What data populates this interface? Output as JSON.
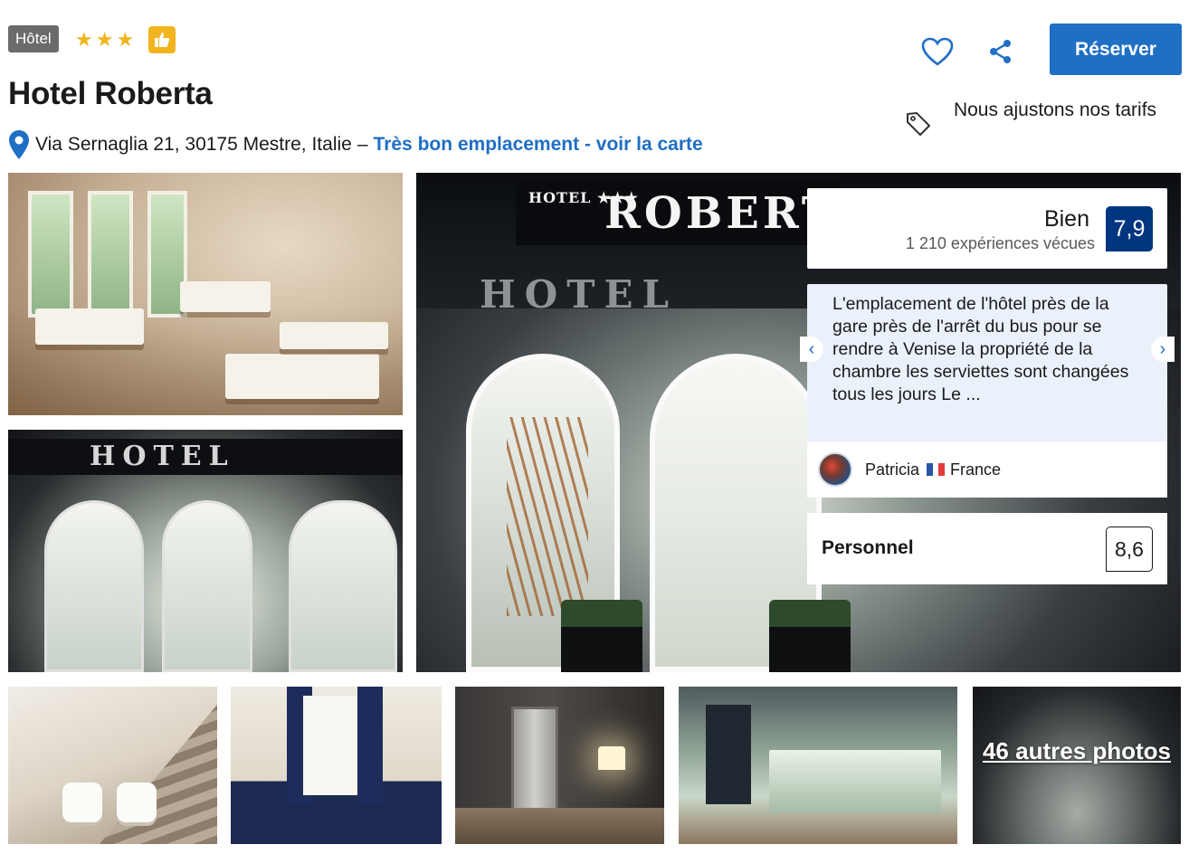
{
  "header": {
    "type_badge": "Hôtel",
    "stars": [
      "★",
      "★",
      "★"
    ],
    "title": "Hotel Roberta",
    "address": "Via Sernaglia 21, 30175 Mestre, Italie",
    "separator": "–",
    "map_link": "Très bon emplacement - voir la carte"
  },
  "actions": {
    "reserve_label": "Réserver",
    "price_note": "Nous ajustons nos tarifs",
    "icons": [
      "heart-icon",
      "share-icon",
      "tag-icon",
      "location-pin-icon",
      "thumbs-up-icon"
    ]
  },
  "colors": {
    "brand_blue": "#1f6fc4",
    "score_blue": "#003580",
    "star_yellow": "#f2b520",
    "review_bg": "#eaf1fb"
  },
  "gallery": {
    "main_sign_small": "HOTEL ★★★",
    "main_sign": "ROBERTA",
    "awning_text": "HOTEL",
    "entrance_sign": "HOTEL",
    "more_photos": "46 autres photos"
  },
  "rating": {
    "label": "Bien",
    "count": "1 210 expériences vécues",
    "score": "7,9"
  },
  "review": {
    "text": "L'emplacement de l'hôtel près de la gare près de l'arrêt du bus pour se rendre à Venise la propriété de la chambre les serviettes sont changées tous les jours Le ...",
    "author": "Patricia",
    "country": "France",
    "prev": "‹",
    "next": "›"
  },
  "staff": {
    "label": "Personnel",
    "score": "8,6"
  }
}
